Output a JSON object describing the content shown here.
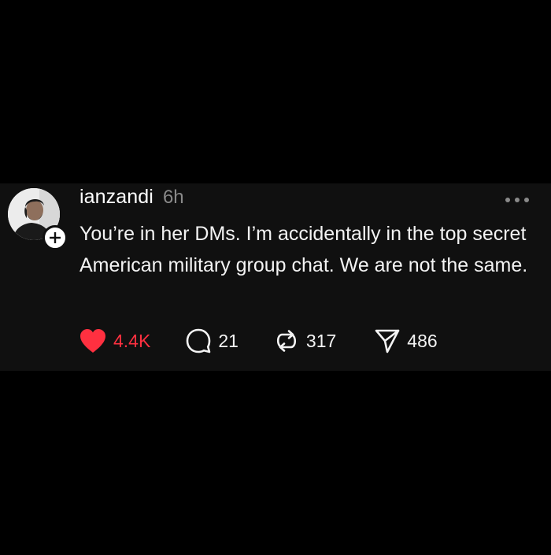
{
  "post": {
    "username": "ianzandi",
    "time": "6h",
    "text": "You’re in her DMs. I’m accidentally in the top secret American military group chat. We are not the same.",
    "like_count": "4.4K",
    "comment_count": "21",
    "repost_count": "317",
    "share_count": "486"
  },
  "colors": {
    "background": "#000000",
    "card": "#101010",
    "like": "#ff3040",
    "muted": "#8a8a8a",
    "text": "#f3f3f3"
  },
  "icons": {
    "avatar": "profile-photo",
    "follow": "plus-icon",
    "more": "more-dots-icon",
    "like": "heart-icon",
    "comment": "comment-icon",
    "repost": "repost-icon",
    "share": "send-icon"
  }
}
